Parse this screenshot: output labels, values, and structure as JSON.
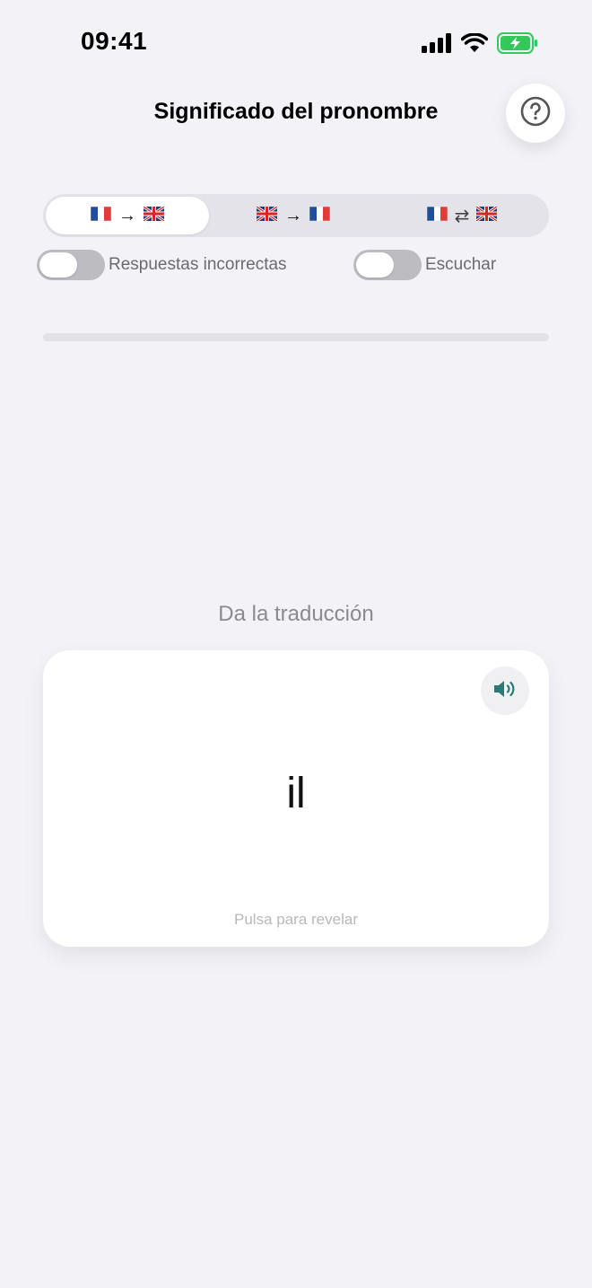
{
  "status_bar": {
    "time": "09:41",
    "icons": [
      "cellular-signal-icon",
      "wifi-icon",
      "battery-charging-icon"
    ],
    "battery_color": "#34c759"
  },
  "header": {
    "title": "Significado del pronombre",
    "help_icon": "question-mark-circle-icon"
  },
  "direction_segments": [
    {
      "from": "flag-fr",
      "arrow": "→",
      "to": "flag-gb",
      "selected": true
    },
    {
      "from": "flag-gb",
      "arrow": "→",
      "to": "flag-fr",
      "selected": false
    },
    {
      "from": "flag-fr",
      "arrow": "⇄",
      "to": "flag-gb",
      "selected": false
    }
  ],
  "toggles": {
    "wrong_answers": {
      "label": "Respuestas incorrectas",
      "on": false
    },
    "listen": {
      "label": "Escuchar",
      "on": false
    }
  },
  "progress": {
    "value": 0,
    "fill_color": "#2b7a74"
  },
  "exercise": {
    "prompt": "Da la traducción",
    "word": "il",
    "hint": "Pulsa para revelar",
    "speaker_icon": "speaker-icon",
    "speaker_color": "#2b7a74"
  }
}
